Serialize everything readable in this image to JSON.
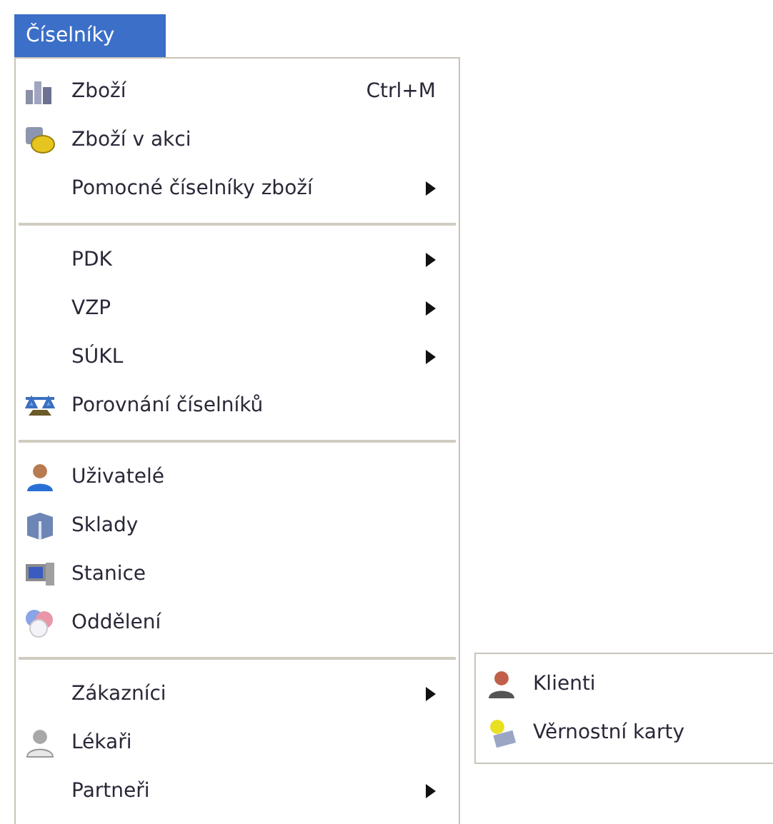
{
  "menu": {
    "title": "Číselníky",
    "items": [
      {
        "kind": "item",
        "label": "Zboží",
        "shortcut": "Ctrl+M",
        "submenu": false
      },
      {
        "kind": "item",
        "label": "Zboží v akci",
        "submenu": false
      },
      {
        "kind": "item",
        "label": "Pomocné číselníky zboží",
        "submenu": true
      },
      {
        "kind": "separator"
      },
      {
        "kind": "item",
        "label": "PDK",
        "submenu": true
      },
      {
        "kind": "item",
        "label": "VZP",
        "submenu": true
      },
      {
        "kind": "item",
        "label": "SÚKL",
        "submenu": true
      },
      {
        "kind": "item",
        "label": "Porovnání číselníků",
        "submenu": false
      },
      {
        "kind": "separator"
      },
      {
        "kind": "item",
        "label": "Uživatelé",
        "submenu": false
      },
      {
        "kind": "item",
        "label": "Sklady",
        "submenu": false
      },
      {
        "kind": "item",
        "label": "Stanice",
        "submenu": false
      },
      {
        "kind": "item",
        "label": "Oddělení",
        "submenu": false
      },
      {
        "kind": "separator"
      },
      {
        "kind": "item",
        "label": "Zákazníci",
        "submenu": true,
        "children": [
          {
            "label": "Klienti"
          },
          {
            "label": "Věrnostní karty"
          }
        ]
      },
      {
        "kind": "item",
        "label": "Lékaři",
        "submenu": false
      },
      {
        "kind": "item",
        "label": "Partneři",
        "submenu": true
      }
    ]
  }
}
